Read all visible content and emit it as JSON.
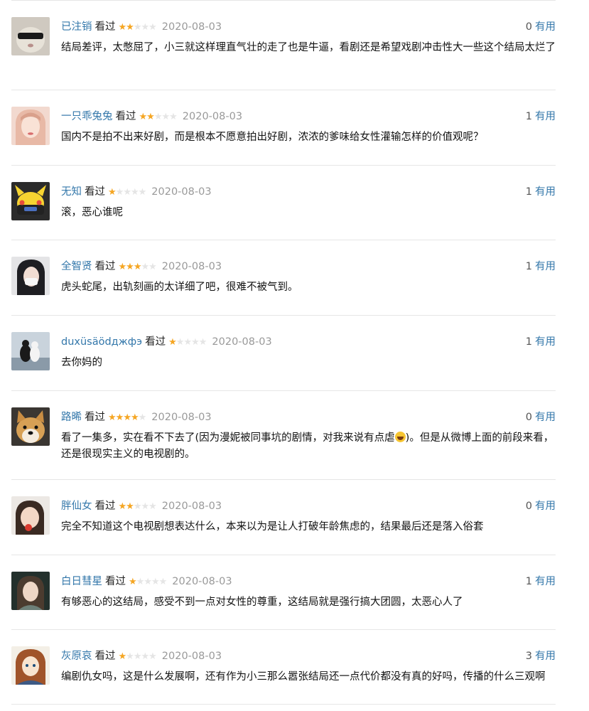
{
  "comments": [
    {
      "user": "已注销",
      "status": "看过",
      "rating": 2,
      "date": "2020-08-03",
      "votes": "0",
      "useful_label": "有用",
      "text": "结局差评，太憋屈了，小三就这样理直气壮的走了也是牛逼，看剧还是希望戏剧冲击性大一些这个结局太烂了"
    },
    {
      "user": "一只乖兔兔",
      "status": "看过",
      "rating": 2,
      "date": "2020-08-03",
      "votes": "1",
      "useful_label": "有用",
      "text": "国内不是拍不出来好剧，而是根本不愿意拍出好剧，浓浓的爹味给女性灌输怎样的价值观呢？"
    },
    {
      "user": "无知",
      "status": "看过",
      "rating": 1,
      "date": "2020-08-03",
      "votes": "1",
      "useful_label": "有用",
      "text": "滚，恶心谁呢"
    },
    {
      "user": "全智贤",
      "status": "看过",
      "rating": 3,
      "date": "2020-08-03",
      "votes": "1",
      "useful_label": "有用",
      "text": "虎头蛇尾，出轨刻画的太详细了吧，很难不被气到。"
    },
    {
      "user": "duxüsäödджфэ",
      "status": "看过",
      "rating": 1,
      "date": "2020-08-03",
      "votes": "1",
      "useful_label": "有用",
      "text": "去你妈的"
    },
    {
      "user": "路晞",
      "status": "看过",
      "rating": 4,
      "date": "2020-08-03",
      "votes": "0",
      "useful_label": "有用",
      "text_before_emoji": "看了一集多，实在看不下去了(因为漫妮被同事坑的剧情，对我来说有点虐",
      "emoji_icon": "laughing-tears-emoji-icon",
      "text_after_emoji": ")。但是从微博上面的前段来看，还是很现实主义的电视剧的。"
    },
    {
      "user": "胖仙女",
      "status": "看过",
      "rating": 2,
      "date": "2020-08-03",
      "votes": "0",
      "useful_label": "有用",
      "text": "完全不知道这个电视剧想表达什么，本来以为是让人打破年龄焦虑的，结果最后还是落入俗套"
    },
    {
      "user": "白日彗星",
      "status": "看过",
      "rating": 1,
      "date": "2020-08-03",
      "votes": "1",
      "useful_label": "有用",
      "text": "有够恶心的这结局，感受不到一点对女性的尊重，这结局就是强行搞大团圆，太恶心人了"
    },
    {
      "user": "灰原哀",
      "status": "看过",
      "rating": 1,
      "date": "2020-08-03",
      "votes": "3",
      "useful_label": "有用",
      "text": "编剧仇女吗，这是什么发展啊，还有作为小三那么嚣张结局还一点代价都没有真的好吗，传播的什么三观啊"
    }
  ],
  "rating_max": 5,
  "star_glyph": "★",
  "colors": {
    "link": "#3377aa",
    "star_on": "#f5a623",
    "star_off": "#e5e5e5",
    "date": "#999999",
    "divider": "#e6e6e6"
  }
}
